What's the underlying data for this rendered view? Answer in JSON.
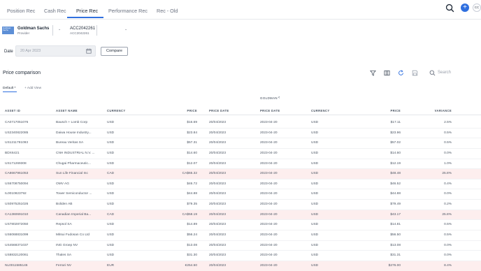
{
  "tabs": [
    {
      "label": "Position Rec"
    },
    {
      "label": "Cash Rec"
    },
    {
      "label": "Price Rec"
    },
    {
      "label": "Performance Rec"
    },
    {
      "label": "Rec - Old"
    }
  ],
  "user": {
    "initials": "CC"
  },
  "accent_color": "#2f6fdf",
  "provider": {
    "logo_text": "Goldman Sachs",
    "name": "Goldman Sachs",
    "sub": "Provider"
  },
  "account": {
    "name": "ACC2042261",
    "sub": "ACC2042261"
  },
  "date": {
    "label": "Date",
    "value": "20 Apr 2023"
  },
  "compare_label": "Compare",
  "section": {
    "title": "Price comparison",
    "search_placeholder": "Search"
  },
  "views": {
    "default": "Default *",
    "add": "+ Add View"
  },
  "group_label": "GOLDMAN",
  "columns": {
    "asset_id": "ASSET ID",
    "asset_name": "ASSET NAME",
    "currency": "CURRENCY",
    "price": "PRICE",
    "price_date": "PRICE DATE",
    "price_date2": "PRICE DATE",
    "currency2": "CURRENCY",
    "price2": "PRICE",
    "variance": "VARIANCE"
  },
  "rows": [
    {
      "id": "CA0717051076",
      "name": "Bausch + Lomb Corp",
      "ccy": "USD",
      "price": "$16.69",
      "date": "20/04/2023",
      "date2": "2023-04-20",
      "ccy2": "USD",
      "price2": "$17.11",
      "variance": "2.5%",
      "diff": false
    },
    {
      "id": "US2340822085",
      "name": "Daiwa House Industry...",
      "ccy": "USD",
      "price": "$23.84",
      "date": "20/04/2023",
      "date2": "2023-04-20",
      "ccy2": "USD",
      "price2": "$23.96",
      "variance": "0.5%",
      "diff": false
    },
    {
      "id": "US1211791093",
      "name": "Bureau Veritas SA",
      "ccy": "USD",
      "price": "$57.31",
      "date": "20/04/2023",
      "date2": "2023-04-20",
      "ccy2": "USD",
      "price2": "$57.02",
      "variance": "0.5%",
      "diff": false
    },
    {
      "id": "BDX6421",
      "name": "CNH INDUSTRIAL N.V. ...",
      "ccy": "USD",
      "price": "$14.60",
      "date": "20/04/2023",
      "date2": "2023-04-20",
      "ccy2": "USD",
      "price2": "$14.60",
      "variance": "0.0%",
      "diff": false
    },
    {
      "id": "US171269308",
      "name": "Chugai Pharmaceutic...",
      "ccy": "USD",
      "price": "$12.07",
      "date": "20/04/2023",
      "date2": "2023-04-20",
      "ccy2": "USD",
      "price2": "$12.19",
      "variance": "1.0%",
      "diff": false
    },
    {
      "id": "CA8667961053",
      "name": "Sun Life Financial Inc",
      "ccy": "CAD",
      "price": "CA$65.32",
      "date": "20/04/2023",
      "date2": "2023-04-20",
      "ccy2": "USD",
      "price2": "$48.48",
      "variance": "25.8%",
      "diff": true
    },
    {
      "id": "US6708750094",
      "name": "OMV AG",
      "ccy": "USD",
      "price": "$46.72",
      "date": "20/04/2023",
      "date2": "2023-04-20",
      "ccy2": "USD",
      "price2": "$46.52",
      "variance": "0.4%",
      "diff": false
    },
    {
      "id": "IL0010823792",
      "name": "Tower Semiconductor ...",
      "ccy": "USD",
      "price": "$44.88",
      "date": "20/04/2023",
      "date2": "2023-04-20",
      "ccy2": "USD",
      "price2": "$44.88",
      "variance": "0.0%",
      "diff": false
    },
    {
      "id": "US0975251026",
      "name": "Boliden AB",
      "ccy": "USD",
      "price": "$79.35",
      "date": "20/04/2023",
      "date2": "2023-04-20",
      "ccy2": "USD",
      "price2": "$79.49",
      "variance": "0.2%",
      "diff": false
    },
    {
      "id": "CA1360691010",
      "name": "Canadian Imperial Ba...",
      "ccy": "CAD",
      "price": "CA$58.19",
      "date": "20/04/2023",
      "date2": "2023-04-20",
      "ccy2": "USD",
      "price2": "$43.17",
      "variance": "25.8%",
      "diff": true
    },
    {
      "id": "US7802872050",
      "name": "Repsol SA",
      "ccy": "USD",
      "price": "$14.89",
      "date": "20/04/2023",
      "date2": "2023-04-20",
      "ccy2": "USD",
      "price2": "$14.81",
      "variance": "0.5%",
      "diff": false
    },
    {
      "id": "US6068831099",
      "name": "Mitsui Fudosan Co Ltd",
      "ccy": "USD",
      "price": "$56.24",
      "date": "20/04/2023",
      "date2": "2023-04-20",
      "ccy2": "USD",
      "price2": "$56.50",
      "variance": "0.5%",
      "diff": false
    },
    {
      "id": "US4568371037",
      "name": "ING Groep NV",
      "ccy": "USD",
      "price": "$13.08",
      "date": "20/04/2023",
      "date2": "2023-04-20",
      "ccy2": "USD",
      "price2": "$13.08",
      "variance": "0.0%",
      "diff": false
    },
    {
      "id": "US8832120061",
      "name": "Thales SA",
      "ccy": "USD",
      "price": "$31.30",
      "date": "20/04/2023",
      "date2": "2023-04-20",
      "ccy2": "USD",
      "price2": "$31.31",
      "variance": "0.0%",
      "diff": false
    },
    {
      "id": "NL0011585146",
      "name": "Ferrari NV",
      "ccy": "EUR",
      "price": "€254.50",
      "date": "20/04/2023",
      "date2": "2023-04-20",
      "ccy2": "USD",
      "price2": "$276.00",
      "variance": "8.4%",
      "diff": true
    }
  ]
}
